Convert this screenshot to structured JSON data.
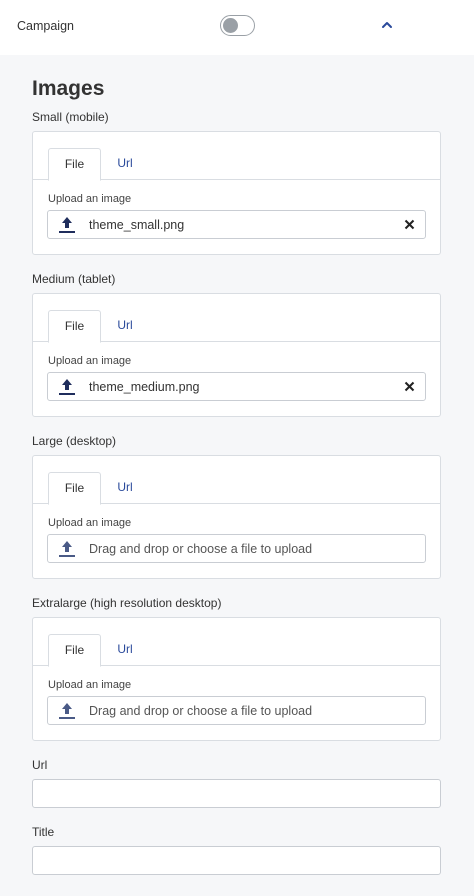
{
  "header": {
    "label": "Campaign",
    "toggle_on": false,
    "accent": "#2a4a9b"
  },
  "images": {
    "heading": "Images",
    "tab_file": "File",
    "tab_url": "Url",
    "upload_label": "Upload an image",
    "placeholder": "Drag and drop or choose a file to upload",
    "slots": [
      {
        "label": "Small (mobile)",
        "file": "theme_small.png"
      },
      {
        "label": "Medium (tablet)",
        "file": "theme_medium.png"
      },
      {
        "label": "Large (desktop)",
        "file": ""
      },
      {
        "label": "Extralarge (high resolution desktop)",
        "file": ""
      }
    ]
  },
  "fields": {
    "url_label": "Url",
    "url_value": "",
    "title_label": "Title",
    "title_value": ""
  }
}
